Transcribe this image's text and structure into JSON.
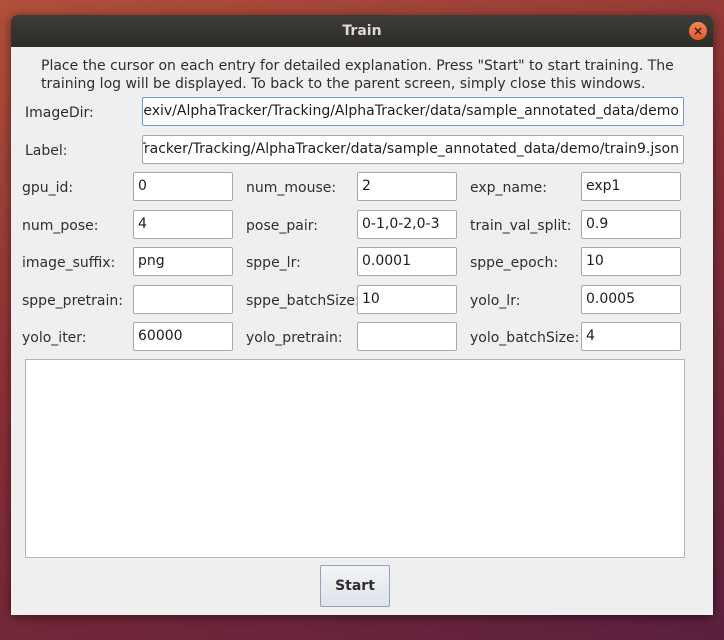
{
  "window": {
    "title": "Train",
    "close_glyph": "×"
  },
  "instructions": "Place the cursor on each entry for detailed explanation. Press \"Start\" to start training. The training log will be displayed. To back to the parent screen, simply close this windows.",
  "paths": {
    "image_dir": {
      "label": "ImageDir:",
      "value": "flexiv/AlphaTracker/Tracking/AlphaTracker/data/sample_annotated_data/demo"
    },
    "label": {
      "label": "Label:",
      "value": "Tracker/Tracking/AlphaTracker/data/sample_annotated_data/demo/train9.json"
    }
  },
  "params": {
    "gpu_id": {
      "label": "gpu_id:",
      "value": "0"
    },
    "num_mouse": {
      "label": "num_mouse:",
      "value": "2"
    },
    "exp_name": {
      "label": "exp_name:",
      "value": "exp1"
    },
    "num_pose": {
      "label": "num_pose:",
      "value": "4"
    },
    "pose_pair": {
      "label": "pose_pair:",
      "value": "0-1,0-2,0-3"
    },
    "train_val_split": {
      "label": "train_val_split:",
      "value": "0.9"
    },
    "image_suffix": {
      "label": "image_suffix:",
      "value": "png"
    },
    "sppe_lr": {
      "label": "sppe_lr:",
      "value": "0.0001"
    },
    "sppe_epoch": {
      "label": "sppe_epoch:",
      "value": "10"
    },
    "sppe_pretrain": {
      "label": "sppe_pretrain:",
      "value": ""
    },
    "sppe_batchSize": {
      "label": "sppe_batchSize:",
      "value": "10"
    },
    "yolo_lr": {
      "label": "yolo_lr:",
      "value": "0.0005"
    },
    "yolo_iter": {
      "label": "yolo_iter:",
      "value": "60000"
    },
    "yolo_pretrain": {
      "label": "yolo_pretrain:",
      "value": ""
    },
    "yolo_batchSize": {
      "label": "yolo_batchSize:",
      "value": "4"
    }
  },
  "log": {
    "text": ""
  },
  "buttons": {
    "start": "Start"
  }
}
